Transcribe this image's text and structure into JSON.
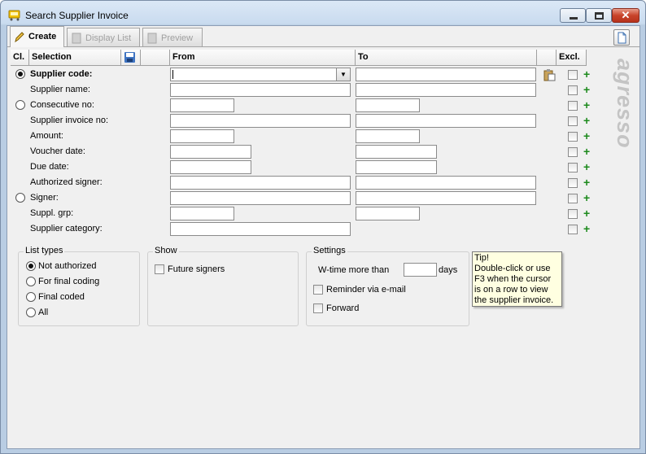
{
  "window": {
    "title": "Search Supplier Invoice"
  },
  "tabs": [
    {
      "label": "Create"
    },
    {
      "label": "Display List"
    },
    {
      "label": "Preview"
    }
  ],
  "grid": {
    "headers": {
      "cl": "Cl.",
      "selection": "Selection",
      "from": "From",
      "to": "To",
      "excl": "Excl."
    },
    "rows": [
      {
        "label": "Supplier code:"
      },
      {
        "label": "Supplier name:"
      },
      {
        "label": "Consecutive no:"
      },
      {
        "label": "Supplier invoice no:"
      },
      {
        "label": "Amount:"
      },
      {
        "label": "Voucher date:"
      },
      {
        "label": "Due date:"
      },
      {
        "label": "Authorized signer:"
      },
      {
        "label": "Signer:"
      },
      {
        "label": "Suppl. grp:"
      },
      {
        "label": "Supplier category:"
      }
    ]
  },
  "watermark": "agresso",
  "list_types": {
    "legend": "List types",
    "options": [
      {
        "label": "Not authorized",
        "selected": true
      },
      {
        "label": "For final coding",
        "selected": false
      },
      {
        "label": "Final coded",
        "selected": false
      },
      {
        "label": "All",
        "selected": false
      }
    ]
  },
  "show": {
    "legend": "Show",
    "future_signers": "Future signers"
  },
  "settings": {
    "legend": "Settings",
    "wtime_label": "W-time more than",
    "wtime_value": "",
    "days_label": "days",
    "reminder": "Reminder via e-mail",
    "forward": "Forward"
  },
  "tip": {
    "title": "Tip!",
    "text": "Double-click or use F3 when the cursor is on a row to view the supplier invoice."
  },
  "colors": {
    "add_plus": "#1c8a1c",
    "tip_bg": "#ffffe1"
  }
}
